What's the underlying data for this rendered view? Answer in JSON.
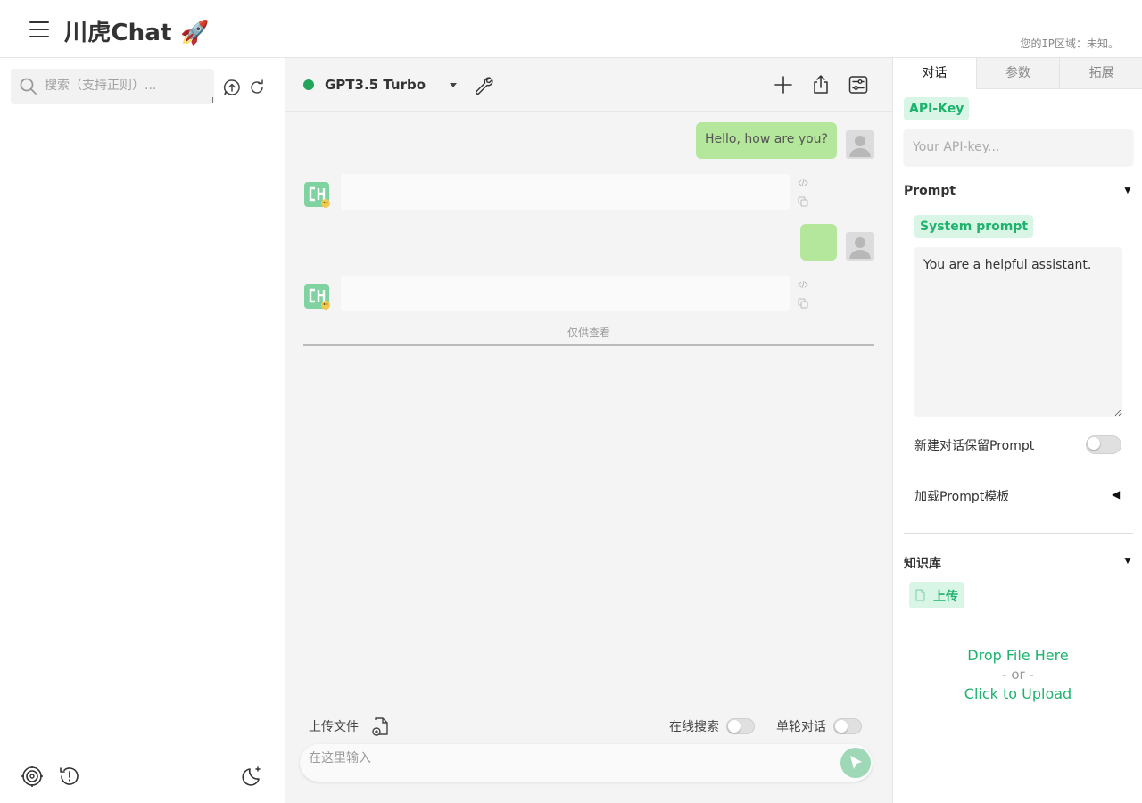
{
  "header": {
    "title": "川虎Chat 🚀",
    "ip_region": "您的IP区域：未知。"
  },
  "sidebar": {
    "search_placeholder": "搜索（支持正则）..."
  },
  "toolbar": {
    "model_name": "GPT3.5 Turbo",
    "status_color": "#22a55a"
  },
  "messages": [
    {
      "role": "user",
      "text": "Hello, how are you?"
    },
    {
      "role": "bot",
      "text": ""
    },
    {
      "role": "user",
      "text": ""
    },
    {
      "role": "bot",
      "text": ""
    }
  ],
  "chat": {
    "view_only_label": "仅供查看",
    "upload_file_label": "上传文件",
    "online_search_label": "在线搜索",
    "single_turn_label": "单轮对话",
    "input_placeholder": "在这里输入"
  },
  "panel": {
    "tabs": [
      "对话",
      "参数",
      "拓展"
    ],
    "active_tab": "对话",
    "api_key_label": "API-Key",
    "api_key_placeholder": "Your API-key...",
    "prompt_section": "Prompt",
    "system_prompt_label": "System prompt",
    "system_prompt_value": "You are a helpful assistant.",
    "keep_prompt_label": "新建对话保留Prompt",
    "load_template_label": "加载Prompt模板",
    "knowledge_section": "知识库",
    "upload_label": "上传",
    "drop_file": "Drop File Here",
    "or_text": "- or -",
    "click_upload": "Click to Upload"
  },
  "colors": {
    "accent": "#1db36d",
    "user_bubble": "#b4e79c",
    "send_button": "#9ed8b7"
  }
}
